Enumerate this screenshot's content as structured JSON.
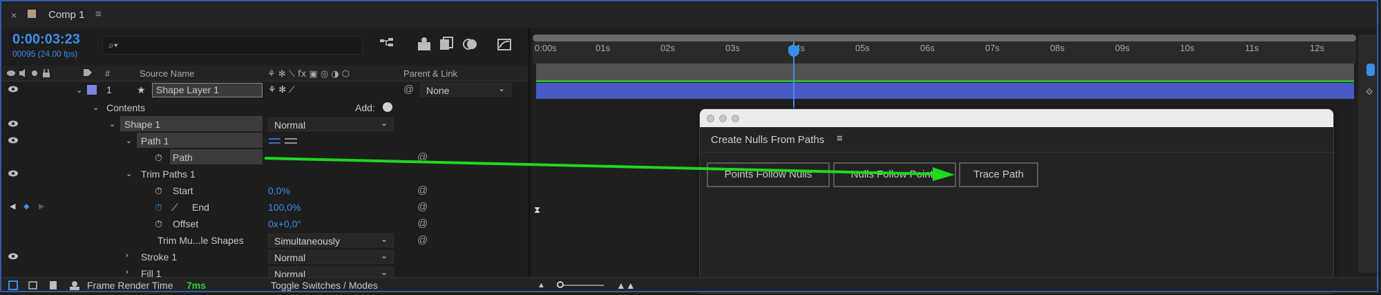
{
  "tab": {
    "close": "×",
    "label": "Comp 1",
    "menu": "≡",
    "swatch_color": "#b2a07d"
  },
  "time": {
    "timecode": "0:00:03:23",
    "fps": "00095 (24.00 fps)"
  },
  "search": {
    "icon": "search-icon",
    "placeholder": "",
    "glyph": "⌕▾"
  },
  "columns": {
    "hash": "#",
    "source": "Source Name",
    "parent": "Parent & Link"
  },
  "layers": {
    "layer1": {
      "num": "1",
      "star": "★",
      "name": "Shape Layer 1",
      "parent": "None",
      "color": "#7b86e0"
    },
    "contents": "Contents",
    "add_label": "Add:",
    "shape1": {
      "label": "Shape 1",
      "blend": "Normal"
    },
    "path1": {
      "label": "Path 1"
    },
    "path": {
      "label": "Path"
    },
    "trim": {
      "label": "Trim Paths 1"
    },
    "start": {
      "label": "Start",
      "value": "0,0%"
    },
    "end": {
      "label": "End",
      "value": "100,0%"
    },
    "offset": {
      "label": "Offset",
      "value": "0x+0,0°"
    },
    "trim_multi": {
      "label": "Trim Mu...le Shapes",
      "value": "Simultaneously"
    },
    "stroke1": {
      "label": "Stroke 1",
      "blend": "Normal"
    },
    "fill1": {
      "label": "Fill 1",
      "blend": "Normal"
    }
  },
  "ruler": [
    "0:00s",
    "01s",
    "02s",
    "03s",
    "04s",
    "05s",
    "06s",
    "07s",
    "08s",
    "09s",
    "10s",
    "11s",
    "12s"
  ],
  "bottom": {
    "render_label": "Frame Render Time",
    "render_value": "7ms",
    "toggle": "Toggle Switches / Modes"
  },
  "panel": {
    "title": "Create Nulls From Paths",
    "menu": "≡",
    "buttons": [
      "Points Follow Nulls",
      "Nulls Follow Points",
      "Trace Path"
    ]
  },
  "colors": {
    "accent": "#3b8ee8",
    "layer_bar": "#4b59c6",
    "arrow": "#1fd81f"
  }
}
